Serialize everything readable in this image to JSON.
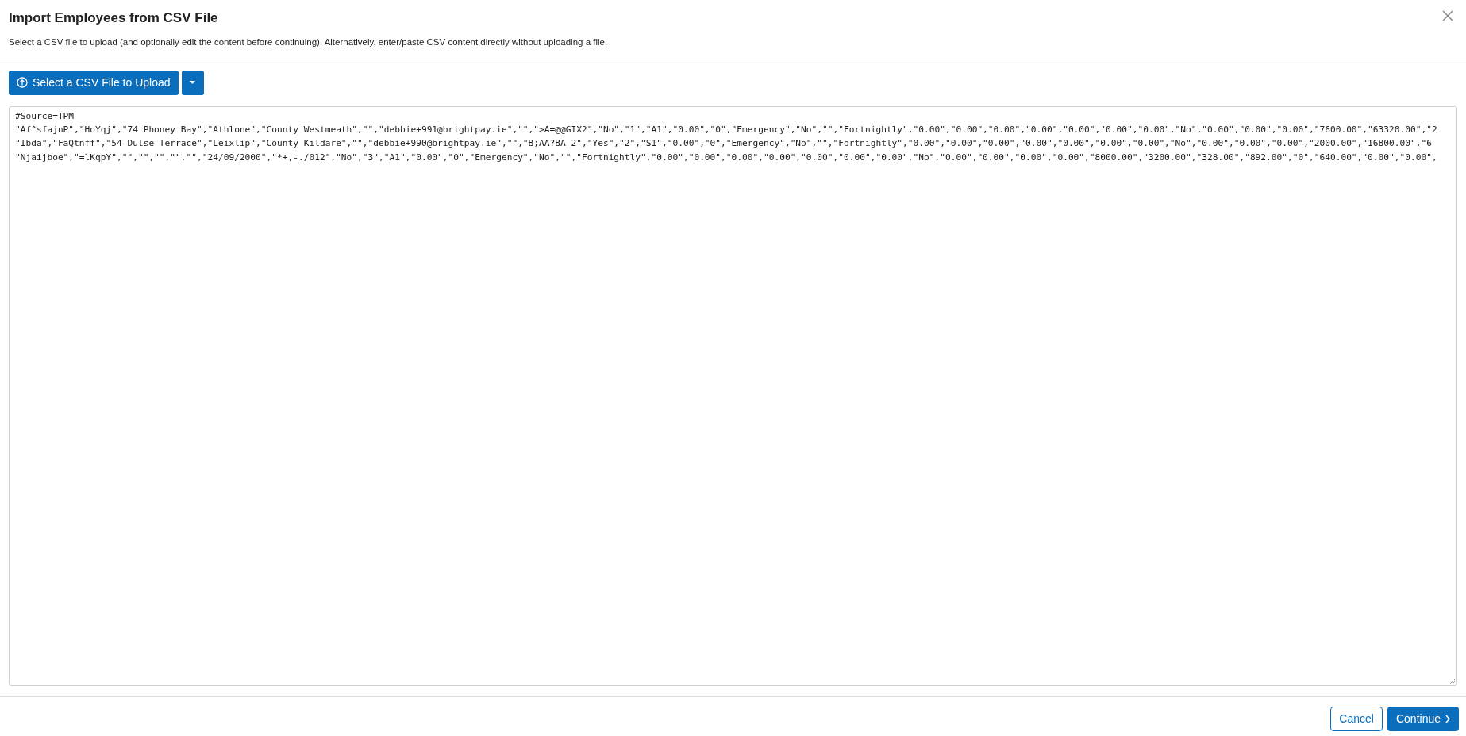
{
  "dialog": {
    "title": "Import Employees from CSV File",
    "description": "Select a CSV file to upload (and optionally edit the content before continuing). Alternatively, enter/paste CSV content directly without uploading a file."
  },
  "upload_button": {
    "label": "Select a CSV File to Upload"
  },
  "csv_content": [
    "#Source=TPM",
    "\"Af^sfajnP\",\"HoYqj\",\"74 Phoney Bay\",\"Athlone\",\"County Westmeath\",\"\",\"debbie+991@brightpay.ie\",\"\",\">A=@@GIX2\",\"No\",\"1\",\"A1\",\"0.00\",\"0\",\"Emergency\",\"No\",\"\",\"Fortnightly\",\"0.00\",\"0.00\",\"0.00\",\"0.00\",\"0.00\",\"0.00\",\"0.00\",\"No\",\"0.00\",\"0.00\",\"0.00\",\"7600.00\",\"63320.00\",\"2",
    "\"Ibda\",\"FaQtnff\",\"54 Dulse Terrace\",\"Leixlip\",\"County Kildare\",\"\",\"debbie+990@brightpay.ie\",\"\",\"B;AA?BA_2\",\"Yes\",\"2\",\"S1\",\"0.00\",\"0\",\"Emergency\",\"No\",\"\",\"Fortnightly\",\"0.00\",\"0.00\",\"0.00\",\"0.00\",\"0.00\",\"0.00\",\"0.00\",\"No\",\"0.00\",\"0.00\",\"0.00\",\"2000.00\",\"16800.00\",\"6",
    "\"Njaijboe\",\"=lKqpY\",\"\",\"\",\"\",\"\",\"\",\"24/09/2000\",\"*+,-./012\",\"No\",\"3\",\"A1\",\"0.00\",\"0\",\"Emergency\",\"No\",\"\",\"Fortnightly\",\"0.00\",\"0.00\",\"0.00\",\"0.00\",\"0.00\",\"0.00\",\"0.00\",\"No\",\"0.00\",\"0.00\",\"0.00\",\"0.00\",\"8000.00\",\"3200.00\",\"328.00\",\"892.00\",\"0\",\"640.00\",\"0.00\",\"0.00\","
  ],
  "buttons": [
    {
      "kind": "secondary",
      "label": "Cancel"
    },
    {
      "kind": "primary",
      "label": "Continue"
    }
  ]
}
